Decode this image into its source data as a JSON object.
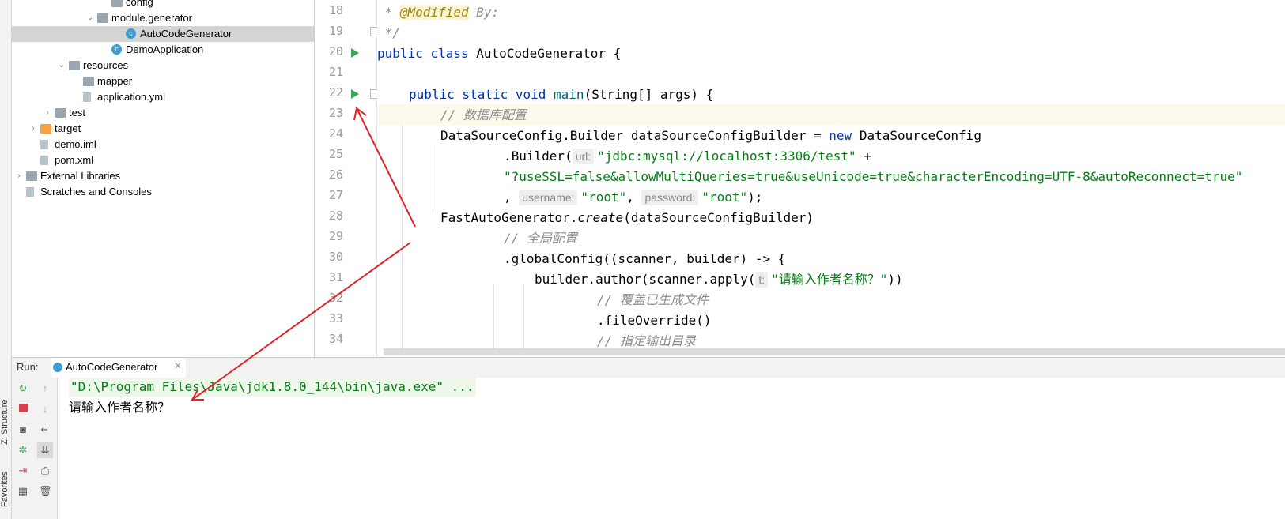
{
  "side_tabs": {
    "structure": "Z: Structure",
    "favorites": "Favorites"
  },
  "project_tree": [
    {
      "label": "config",
      "icon": "folder-icon",
      "indent": 7,
      "expanded": null
    },
    {
      "label": "module.generator",
      "icon": "package-icon",
      "indent": 6,
      "expanded": true
    },
    {
      "label": "AutoCodeGenerator",
      "icon": "java-class-icon",
      "indent": 8,
      "expanded": null,
      "selected": true
    },
    {
      "label": "DemoApplication",
      "icon": "spring-class-icon",
      "indent": 7,
      "expanded": null
    },
    {
      "label": "resources",
      "icon": "resources-folder-icon",
      "indent": 4,
      "expanded": true
    },
    {
      "label": "mapper",
      "icon": "folder-icon",
      "indent": 5,
      "expanded": null
    },
    {
      "label": "application.yml",
      "icon": "yaml-file-icon",
      "indent": 5,
      "expanded": null
    },
    {
      "label": "test",
      "icon": "folder-icon",
      "indent": 3,
      "expanded": false
    },
    {
      "label": "target",
      "icon": "orange-folder-icon",
      "indent": 2,
      "expanded": false
    },
    {
      "label": "demo.iml",
      "icon": "iml-file-icon",
      "indent": 2,
      "expanded": null
    },
    {
      "label": "pom.xml",
      "icon": "maven-file-icon",
      "indent": 2,
      "expanded": null
    },
    {
      "label": "External Libraries",
      "icon": "libraries-icon",
      "indent": 1,
      "expanded": false
    },
    {
      "label": "Scratches and Consoles",
      "icon": "scratches-icon",
      "indent": 1,
      "expanded": null
    }
  ],
  "editor": {
    "line_numbers": [
      "18",
      "19",
      "20",
      "21",
      "22",
      "23",
      "24",
      "25",
      "26",
      "27",
      "28",
      "29",
      "30",
      "31",
      "32",
      "33",
      "34"
    ],
    "lines": {
      "l18_star": " * ",
      "l18_anno": "@Modified",
      "l18_rest": " By:",
      "l19": " */",
      "l20_kw": "public class",
      "l20_rest": " AutoCodeGenerator {",
      "l22_kw": "public static void",
      "l22_fn": " main",
      "l22_rest": "(String[] args) {",
      "l23": "// 数据库配置",
      "l24_a": "DataSourceConfig.Builder dataSourceConfigBuilder = ",
      "l24_kw": "new",
      "l24_b": " DataSourceConfig",
      "l25_a": ".Builder(",
      "l25_hint": "url:",
      "l25_str": "\"jdbc:mysql://localhost:3306/test\"",
      "l25_b": " +",
      "l26_str": "\"?useSSL=false&allowMultiQueries=true&useUnicode=true&characterEncoding=UTF-8&autoReconnect=true\"",
      "l27_a": ", ",
      "l27_hint1": "username:",
      "l27_str1": "\"root\"",
      "l27_b": ", ",
      "l27_hint2": "password:",
      "l27_str2": "\"root\"",
      "l27_c": ");",
      "l28_a": "FastAutoGenerator.",
      "l28_it": "create",
      "l28_b": "(dataSourceConfigBuilder)",
      "l29": "// 全局配置",
      "l30": ".globalConfig((scanner, builder) -> {",
      "l31_a": "builder.author(scanner.apply(",
      "l31_hint": "t:",
      "l31_str": "\"请输入作者名称？\"",
      "l31_b": "))",
      "l32": "// 覆盖已生成文件",
      "l33": ".fileOverride()",
      "l34": "// 指定输出目录"
    }
  },
  "run_panel": {
    "label": "Run:",
    "tab_title": "AutoCodeGenerator",
    "console_lines": [
      "\"D:\\Program Files\\Java\\jdk1.8.0_144\\bin\\java.exe\" ...",
      "请输入作者名称？"
    ]
  },
  "colors": {
    "keyword": "#0033b3",
    "string": "#067d17",
    "comment": "#8c8c8c",
    "annotation_arrow": "#e0242a",
    "run_green": "#3aa55b"
  }
}
